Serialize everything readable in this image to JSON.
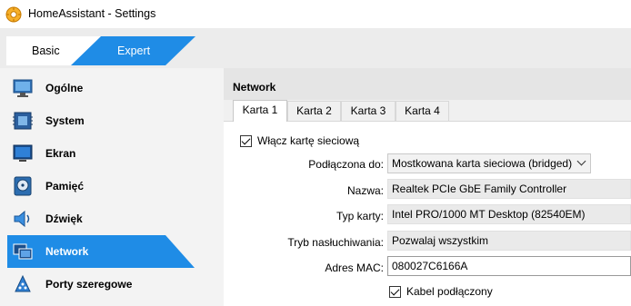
{
  "window": {
    "title": "HomeAssistant - Settings"
  },
  "mode": {
    "basic_label": "Basic",
    "expert_label": "Expert",
    "selected": "Expert"
  },
  "colors": {
    "accent": "#1f8ce6",
    "sidebar_bg": "#f3f3f3",
    "header_bg": "#e5e5e5"
  },
  "sidebar": {
    "items": [
      {
        "label": "Ogólne",
        "icon": "general-monitor-icon"
      },
      {
        "label": "System",
        "icon": "system-chip-icon"
      },
      {
        "label": "Ekran",
        "icon": "display-icon"
      },
      {
        "label": "Pamięć",
        "icon": "storage-disk-icon"
      },
      {
        "label": "Dźwięk",
        "icon": "audio-speaker-icon"
      },
      {
        "label": "Network",
        "icon": "network-icon",
        "active": true
      },
      {
        "label": "Porty szeregowe",
        "icon": "serial-ports-icon"
      }
    ]
  },
  "main": {
    "title": "Network",
    "tabs": [
      {
        "label": "Karta 1",
        "active": true
      },
      {
        "label": "Karta 2"
      },
      {
        "label": "Karta 3"
      },
      {
        "label": "Karta 4"
      }
    ],
    "enable_adapter": {
      "label": "Włącz kartę sieciową",
      "checked": true
    },
    "attached_to": {
      "label": "Podłączona do:",
      "value": "Mostkowana karta sieciowa (bridged)"
    },
    "name": {
      "label": "Nazwa:",
      "value": "Realtek PCIe GbE Family Controller"
    },
    "adapter_type": {
      "label": "Typ karty:",
      "value": "Intel PRO/1000 MT Desktop (82540EM)"
    },
    "promiscuous": {
      "label": "Tryb nasłuchiwania:",
      "value": "Pozwalaj wszystkim"
    },
    "mac": {
      "label": "Adres MAC:",
      "value": "080027C6166A"
    },
    "cable": {
      "label": "Kabel podłączony",
      "checked": true
    }
  }
}
